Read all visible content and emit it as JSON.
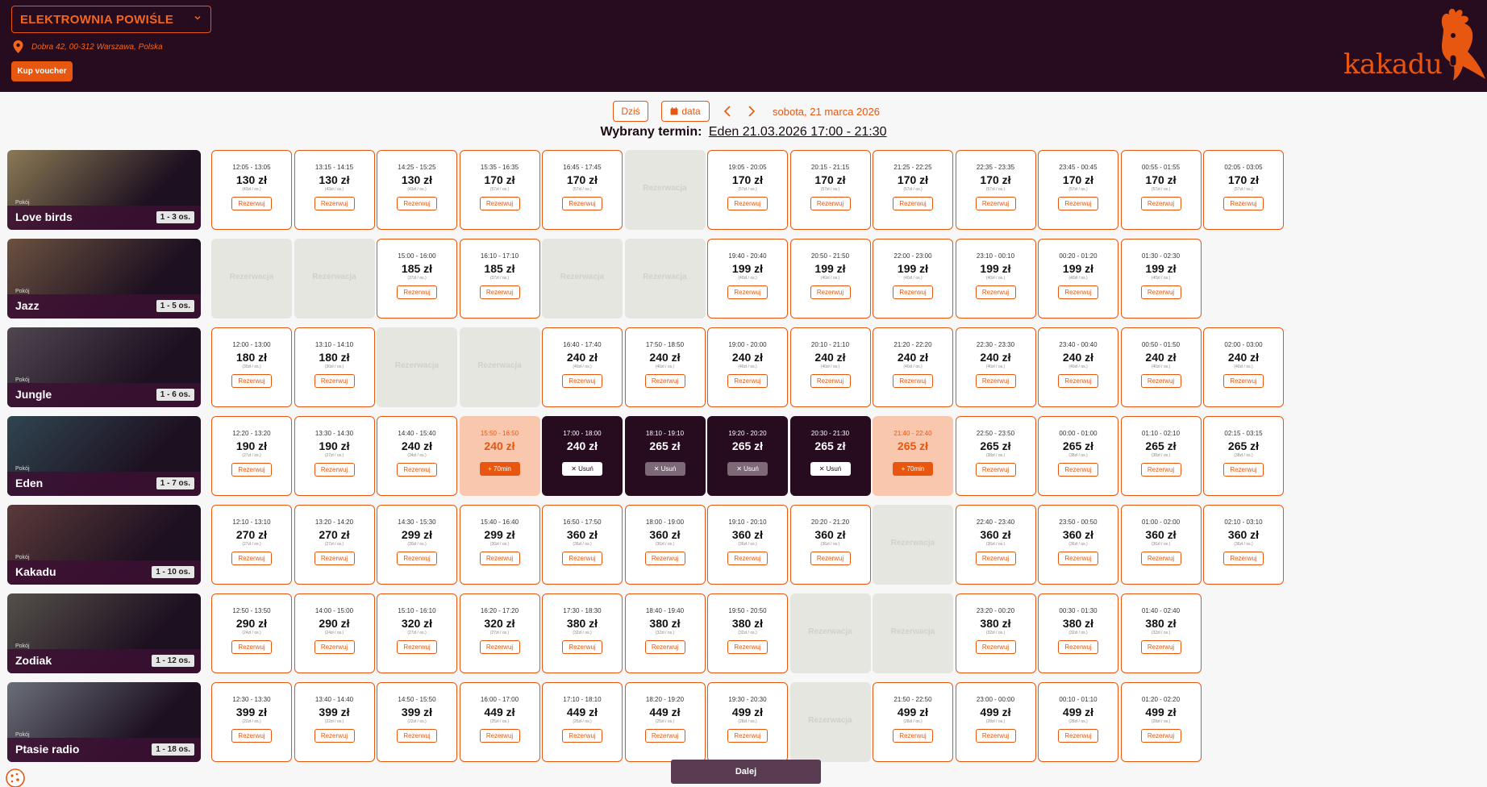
{
  "header": {
    "venue": "ELEKTROWNIA POWIŚLE",
    "address": "Dobra 42, 00-312 Warszawa, Polska",
    "voucher_label": "Kup voucher",
    "logo_text": "kakadu"
  },
  "datebar": {
    "today_label": "Dziś",
    "date_label": "data",
    "current_date": "sobota, 21 marca 2026"
  },
  "selection": {
    "label": "Wybrany termin:",
    "value": "Eden 21.03.2026 17:00 - 21:30"
  },
  "labels": {
    "reserve": "Rezerwuj",
    "booked": "Rezerwacja",
    "remove": "Usuń",
    "extend": "+ 70min",
    "room_prefix": "Pokój",
    "next": "Dalej"
  },
  "colors": {
    "header_bg": "#270b1f",
    "accent": "#e8570f",
    "booked_bg": "#e5e6df",
    "extend_bg": "#f9c7ad"
  },
  "rooms": [
    {
      "name": "Love birds",
      "capacity": "1 - 3",
      "image_hue": "#8a7a55",
      "slots": [
        {
          "state": "free",
          "time": "12:05 - 13:05",
          "price": "130 zł",
          "per": "(43zł / os.)"
        },
        {
          "state": "free",
          "time": "13:15 - 14:15",
          "price": "130 zł",
          "per": "(43zł / os.)"
        },
        {
          "state": "free",
          "time": "14:25 - 15:25",
          "price": "130 zł",
          "per": "(43zł / os.)"
        },
        {
          "state": "free",
          "time": "15:35 - 16:35",
          "price": "170 zł",
          "per": "(57zł / os.)"
        },
        {
          "state": "free",
          "time": "16:45 - 17:45",
          "price": "170 zł",
          "per": "(57zł / os.)"
        },
        {
          "state": "booked"
        },
        {
          "state": "free",
          "time": "19:05 - 20:05",
          "price": "170 zł",
          "per": "(57zł / os.)"
        },
        {
          "state": "free",
          "time": "20:15 - 21:15",
          "price": "170 zł",
          "per": "(57zł / os.)"
        },
        {
          "state": "free",
          "time": "21:25 - 22:25",
          "price": "170 zł",
          "per": "(57zł / os.)"
        },
        {
          "state": "free",
          "time": "22:35 - 23:35",
          "price": "170 zł",
          "per": "(57zł / os.)"
        },
        {
          "state": "free",
          "time": "23:45 - 00:45",
          "price": "170 zł",
          "per": "(57zł / os.)"
        },
        {
          "state": "free",
          "time": "00:55 - 01:55",
          "price": "170 zł",
          "per": "(57zł / os.)"
        },
        {
          "state": "free",
          "time": "02:05 - 03:05",
          "price": "170 zł",
          "per": "(57zł / os.)"
        }
      ]
    },
    {
      "name": "Jazz",
      "capacity": "1 - 5",
      "image_hue": "#6b5140",
      "slots": [
        {
          "state": "booked"
        },
        {
          "state": "booked"
        },
        {
          "state": "free",
          "time": "15:00 - 16:00",
          "price": "185 zł",
          "per": "(37zł / os.)"
        },
        {
          "state": "free",
          "time": "16:10 - 17:10",
          "price": "185 zł",
          "per": "(37zł / os.)"
        },
        {
          "state": "booked"
        },
        {
          "state": "booked"
        },
        {
          "state": "free",
          "time": "19:40 - 20:40",
          "price": "199 zł",
          "per": "(40zł / os.)"
        },
        {
          "state": "free",
          "time": "20:50 - 21:50",
          "price": "199 zł",
          "per": "(40zł / os.)"
        },
        {
          "state": "free",
          "time": "22:00 - 23:00",
          "price": "199 zł",
          "per": "(40zł / os.)"
        },
        {
          "state": "free",
          "time": "23:10 - 00:10",
          "price": "199 zł",
          "per": "(40zł / os.)"
        },
        {
          "state": "free",
          "time": "00:20 - 01:20",
          "price": "199 zł",
          "per": "(40zł / os.)"
        },
        {
          "state": "free",
          "time": "01:30 - 02:30",
          "price": "199 zł",
          "per": "(40zł / os.)"
        }
      ]
    },
    {
      "name": "Jungle",
      "capacity": "1 - 6",
      "image_hue": "#4f4650",
      "slots": [
        {
          "state": "free",
          "time": "12:00 - 13:00",
          "price": "180 zł",
          "per": "(30zł / os.)"
        },
        {
          "state": "free",
          "time": "13:10 - 14:10",
          "price": "180 zł",
          "per": "(30zł / os.)"
        },
        {
          "state": "booked"
        },
        {
          "state": "booked"
        },
        {
          "state": "free",
          "time": "16:40 - 17:40",
          "price": "240 zł",
          "per": "(40zł / os.)"
        },
        {
          "state": "free",
          "time": "17:50 - 18:50",
          "price": "240 zł",
          "per": "(40zł / os.)"
        },
        {
          "state": "free",
          "time": "19:00 - 20:00",
          "price": "240 zł",
          "per": "(40zł / os.)"
        },
        {
          "state": "free",
          "time": "20:10 - 21:10",
          "price": "240 zł",
          "per": "(40zł / os.)"
        },
        {
          "state": "free",
          "time": "21:20 - 22:20",
          "price": "240 zł",
          "per": "(40zł / os.)"
        },
        {
          "state": "free",
          "time": "22:30 - 23:30",
          "price": "240 zł",
          "per": "(40zł / os.)"
        },
        {
          "state": "free",
          "time": "23:40 - 00:40",
          "price": "240 zł",
          "per": "(40zł / os.)"
        },
        {
          "state": "free",
          "time": "00:50 - 01:50",
          "price": "240 zł",
          "per": "(40zł / os.)"
        },
        {
          "state": "free",
          "time": "02:00 - 03:00",
          "price": "240 zł",
          "per": "(40zł / os.)"
        }
      ]
    },
    {
      "name": "Eden",
      "capacity": "1 - 7",
      "image_hue": "#2f4550",
      "slots": [
        {
          "state": "free",
          "time": "12:20 - 13:20",
          "price": "190 zł",
          "per": "(27zł / os.)"
        },
        {
          "state": "free",
          "time": "13:30 - 14:30",
          "price": "190 zł",
          "per": "(27zł / os.)"
        },
        {
          "state": "free",
          "time": "14:40 - 15:40",
          "price": "240 zł",
          "per": "(34zł / os.)"
        },
        {
          "state": "extend",
          "time": "15:50 - 16:50",
          "price": "240 zł"
        },
        {
          "state": "selected",
          "time": "17:00 - 18:00",
          "price": "240 zł"
        },
        {
          "state": "selected-muted",
          "time": "18:10 - 19:10",
          "price": "265 zł"
        },
        {
          "state": "selected-muted",
          "time": "19:20 - 20:20",
          "price": "265 zł"
        },
        {
          "state": "selected",
          "time": "20:30 - 21:30",
          "price": "265 zł"
        },
        {
          "state": "extend",
          "time": "21:40 - 22:40",
          "price": "265 zł"
        },
        {
          "state": "free",
          "time": "22:50 - 23:50",
          "price": "265 zł",
          "per": "(38zł / os.)"
        },
        {
          "state": "free",
          "time": "00:00 - 01:00",
          "price": "265 zł",
          "per": "(38zł / os.)"
        },
        {
          "state": "free",
          "time": "01:10 - 02:10",
          "price": "265 zł",
          "per": "(38zł / os.)"
        },
        {
          "state": "free",
          "time": "02:15 - 03:15",
          "price": "265 zł",
          "per": "(38zł / os.)"
        }
      ]
    },
    {
      "name": "Kakadu",
      "capacity": "1 - 10",
      "image_hue": "#5a3a3a",
      "slots": [
        {
          "state": "free",
          "time": "12:10 - 13:10",
          "price": "270 zł",
          "per": "(27zł / os.)"
        },
        {
          "state": "free",
          "time": "13:20 - 14:20",
          "price": "270 zł",
          "per": "(27zł / os.)"
        },
        {
          "state": "free",
          "time": "14:30 - 15:30",
          "price": "299 zł",
          "per": "(30zł / os.)"
        },
        {
          "state": "free",
          "time": "15:40 - 16:40",
          "price": "299 zł",
          "per": "(30zł / os.)"
        },
        {
          "state": "free",
          "time": "16:50 - 17:50",
          "price": "360 zł",
          "per": "(36zł / os.)"
        },
        {
          "state": "free",
          "time": "18:00 - 19:00",
          "price": "360 zł",
          "per": "(36zł / os.)"
        },
        {
          "state": "free",
          "time": "19:10 - 20:10",
          "price": "360 zł",
          "per": "(36zł / os.)"
        },
        {
          "state": "free",
          "time": "20:20 - 21:20",
          "price": "360 zł",
          "per": "(36zł / os.)"
        },
        {
          "state": "booked"
        },
        {
          "state": "free",
          "time": "22:40 - 23:40",
          "price": "360 zł",
          "per": "(36zł / os.)"
        },
        {
          "state": "free",
          "time": "23:50 - 00:50",
          "price": "360 zł",
          "per": "(36zł / os.)"
        },
        {
          "state": "free",
          "time": "01:00 - 02:00",
          "price": "360 zł",
          "per": "(36zł / os.)"
        },
        {
          "state": "free",
          "time": "02:10 - 03:10",
          "price": "360 zł",
          "per": "(36zł / os.)"
        }
      ]
    },
    {
      "name": "Zodiak",
      "capacity": "1 - 12",
      "image_hue": "#55504a",
      "slots": [
        {
          "state": "free",
          "time": "12:50 - 13:50",
          "price": "290 zł",
          "per": "(24zł / os.)"
        },
        {
          "state": "free",
          "time": "14:00 - 15:00",
          "price": "290 zł",
          "per": "(24zł / os.)"
        },
        {
          "state": "free",
          "time": "15:10 - 16:10",
          "price": "320 zł",
          "per": "(27zł / os.)"
        },
        {
          "state": "free",
          "time": "16:20 - 17:20",
          "price": "320 zł",
          "per": "(27zł / os.)"
        },
        {
          "state": "free",
          "time": "17:30 - 18:30",
          "price": "380 zł",
          "per": "(32zł / os.)"
        },
        {
          "state": "free",
          "time": "18:40 - 19:40",
          "price": "380 zł",
          "per": "(32zł / os.)"
        },
        {
          "state": "free",
          "time": "19:50 - 20:50",
          "price": "380 zł",
          "per": "(32zł / os.)"
        },
        {
          "state": "booked"
        },
        {
          "state": "booked"
        },
        {
          "state": "free",
          "time": "23:20 - 00:20",
          "price": "380 zł",
          "per": "(32zł / os.)"
        },
        {
          "state": "free",
          "time": "00:30 - 01:30",
          "price": "380 zł",
          "per": "(32zł / os.)"
        },
        {
          "state": "free",
          "time": "01:40 - 02:40",
          "price": "380 zł",
          "per": "(32zł / os.)"
        }
      ]
    },
    {
      "name": "Ptasie radio",
      "capacity": "1 - 18",
      "image_hue": "#6a6e78",
      "slots": [
        {
          "state": "free",
          "time": "12:30 - 13:30",
          "price": "399 zł",
          "per": "(22zł / os.)"
        },
        {
          "state": "free",
          "time": "13:40 - 14:40",
          "price": "399 zł",
          "per": "(22zł / os.)"
        },
        {
          "state": "free",
          "time": "14:50 - 15:50",
          "price": "399 zł",
          "per": "(22zł / os.)"
        },
        {
          "state": "free",
          "time": "16:00 - 17:00",
          "price": "449 zł",
          "per": "(25zł / os.)"
        },
        {
          "state": "free",
          "time": "17:10 - 18:10",
          "price": "449 zł",
          "per": "(25zł / os.)"
        },
        {
          "state": "free",
          "time": "18:20 - 19:20",
          "price": "449 zł",
          "per": "(25zł / os.)"
        },
        {
          "state": "free",
          "time": "19:30 - 20:30",
          "price": "499 zł",
          "per": "(28zł / os.)"
        },
        {
          "state": "booked"
        },
        {
          "state": "free",
          "time": "21:50 - 22:50",
          "price": "499 zł",
          "per": "(28zł / os.)"
        },
        {
          "state": "free",
          "time": "23:00 - 00:00",
          "price": "499 zł",
          "per": "(28zł / os.)"
        },
        {
          "state": "free",
          "time": "00:10 - 01:10",
          "price": "499 zł",
          "per": "(28zł / os.)"
        },
        {
          "state": "free",
          "time": "01:20 - 02:20",
          "price": "499 zł",
          "per": "(28zł / os.)"
        }
      ]
    }
  ]
}
